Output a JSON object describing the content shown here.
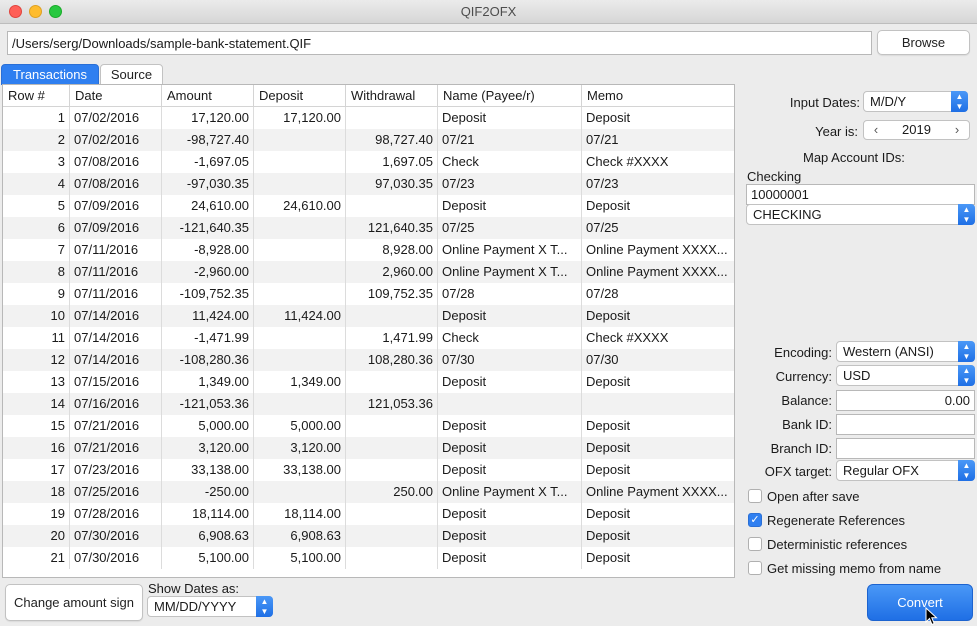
{
  "window": {
    "title": "QIF2OFX"
  },
  "file": {
    "path": "/Users/serg/Downloads/sample-bank-statement.QIF",
    "browse_label": "Browse"
  },
  "tabs": [
    {
      "label": "Transactions"
    },
    {
      "label": "Source"
    }
  ],
  "table": {
    "columns": [
      "Row #",
      "Date",
      "Amount",
      "Deposit",
      "Withdrawal",
      "Name (Payee/r)",
      "Memo"
    ],
    "rows": [
      [
        "1",
        "07/02/2016",
        "17,120.00",
        "17,120.00",
        "",
        "Deposit",
        "Deposit"
      ],
      [
        "2",
        "07/02/2016",
        "-98,727.40",
        "",
        "98,727.40",
        "07/21",
        "07/21"
      ],
      [
        "3",
        "07/08/2016",
        "-1,697.05",
        "",
        "1,697.05",
        "Check",
        "Check #XXXX"
      ],
      [
        "4",
        "07/08/2016",
        "-97,030.35",
        "",
        "97,030.35",
        "07/23",
        "07/23"
      ],
      [
        "5",
        "07/09/2016",
        "24,610.00",
        "24,610.00",
        "",
        "Deposit",
        "Deposit"
      ],
      [
        "6",
        "07/09/2016",
        "-121,640.35",
        "",
        "121,640.35",
        "07/25",
        "07/25"
      ],
      [
        "7",
        "07/11/2016",
        "-8,928.00",
        "",
        "8,928.00",
        "Online Payment X T...",
        "Online Payment XXXX..."
      ],
      [
        "8",
        "07/11/2016",
        "-2,960.00",
        "",
        "2,960.00",
        "Online Payment X T...",
        "Online Payment XXXX..."
      ],
      [
        "9",
        "07/11/2016",
        "-109,752.35",
        "",
        "109,752.35",
        "07/28",
        "07/28"
      ],
      [
        "10",
        "07/14/2016",
        "11,424.00",
        "11,424.00",
        "",
        "Deposit",
        "Deposit"
      ],
      [
        "11",
        "07/14/2016",
        "-1,471.99",
        "",
        "1,471.99",
        "Check",
        "Check #XXXX"
      ],
      [
        "12",
        "07/14/2016",
        "-108,280.36",
        "",
        "108,280.36",
        "07/30",
        "07/30"
      ],
      [
        "13",
        "07/15/2016",
        "1,349.00",
        "1,349.00",
        "",
        "Deposit",
        "Deposit"
      ],
      [
        "14",
        "07/16/2016",
        "-121,053.36",
        "",
        "121,053.36",
        "",
        ""
      ],
      [
        "15",
        "07/21/2016",
        "5,000.00",
        "5,000.00",
        "",
        "Deposit",
        "Deposit"
      ],
      [
        "16",
        "07/21/2016",
        "3,120.00",
        "3,120.00",
        "",
        "Deposit",
        "Deposit"
      ],
      [
        "17",
        "07/23/2016",
        "33,138.00",
        "33,138.00",
        "",
        "Deposit",
        "Deposit"
      ],
      [
        "18",
        "07/25/2016",
        "-250.00",
        "",
        "250.00",
        "Online Payment X T...",
        "Online Payment XXXX..."
      ],
      [
        "19",
        "07/28/2016",
        "18,114.00",
        "18,114.00",
        "",
        "Deposit",
        "Deposit"
      ],
      [
        "20",
        "07/30/2016",
        "6,908.63",
        "6,908.63",
        "",
        "Deposit",
        "Deposit"
      ],
      [
        "21",
        "07/30/2016",
        "5,100.00",
        "5,100.00",
        "",
        "Deposit",
        "Deposit"
      ]
    ]
  },
  "settings": {
    "input_dates_label": "Input Dates:",
    "input_dates_value": "M/D/Y",
    "year_label": "Year is:",
    "year_value": "2019",
    "map_accounts_label": "Map Account IDs:",
    "account_name": "Checking",
    "account_id": "10000001",
    "account_type": "CHECKING",
    "encoding_label": "Encoding:",
    "encoding_value": "Western (ANSI)",
    "currency_label": "Currency:",
    "currency_value": "USD",
    "balance_label": "Balance:",
    "balance_value": "0.00",
    "bank_id_label": "Bank ID:",
    "bank_id_value": "",
    "branch_id_label": "Branch ID:",
    "branch_id_value": "",
    "ofx_target_label": "OFX target:",
    "ofx_target_value": "Regular OFX"
  },
  "options": [
    {
      "label": "Open after save",
      "checked": false
    },
    {
      "label": "Regenerate References",
      "checked": true
    },
    {
      "label": "Deterministic references",
      "checked": false
    },
    {
      "label": "Get missing memo from name",
      "checked": false
    }
  ],
  "bottom": {
    "change_sign_label": "Change amount sign",
    "show_dates_label": "Show Dates as:",
    "show_dates_value": "MM/DD/YYYY",
    "convert_label": "Convert"
  },
  "colors": {
    "accent": "#2f7ff0",
    "checkmark": "✓"
  }
}
